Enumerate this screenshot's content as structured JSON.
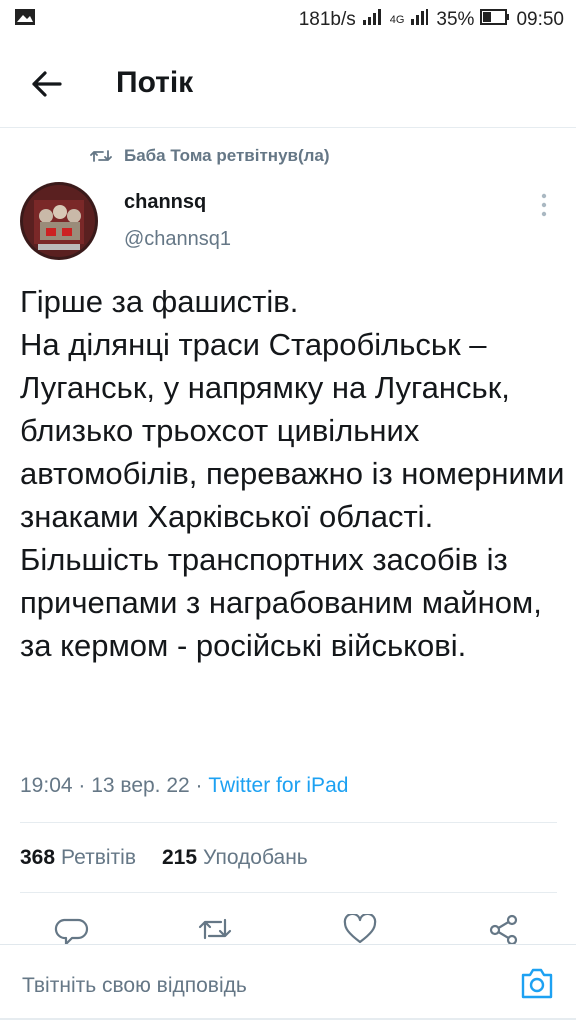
{
  "status_bar": {
    "network_speed": "181b/s",
    "network_type": "4G",
    "battery": "35%",
    "time": "09:50",
    "icons": [
      "image-icon",
      "signal-icon",
      "battery-icon"
    ]
  },
  "header": {
    "title": "Потік",
    "back_icon": "arrow-left-icon"
  },
  "tweet": {
    "retweet_context": "Баба Тома ретвітнув(ла)",
    "author_name": "channsq",
    "author_handle": "@channsq1",
    "text": "Гірше за фашистів.\nНа ділянці траси Старобільськ – Луганськ, у напрямку на Луганськ, близько трьохсот цивільних автомобілів, переважно із номерними знаками Харківської області. Більшість транспортних засобів із причепами з награбованим майном, за кермом - російські військові.",
    "time": "19:04 · 13 вер. 22 · ",
    "source": "Twitter for iPad",
    "retweets_count": "368",
    "retweets_label": "Ретвітів",
    "likes_count": "215",
    "likes_label": "Уподобань"
  },
  "actions": [
    "reply-icon",
    "retweet-icon",
    "like-icon",
    "share-icon"
  ],
  "reply_bar": {
    "placeholder": "Твітніть свою відповідь",
    "camera_icon": "camera-icon"
  },
  "colors": {
    "accent": "#1da1f2",
    "secondary_text": "#657786",
    "primary_text": "#14171a",
    "divider": "#e6ecf0"
  }
}
